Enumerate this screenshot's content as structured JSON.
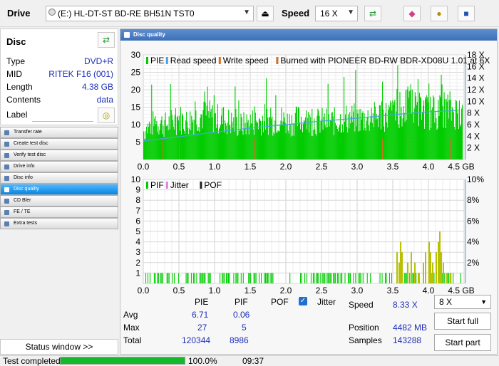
{
  "toolbar": {
    "drive_label": "Drive",
    "drive_value": "(E:)  HL-DT-ST BD-RE  BH51N TST0",
    "speed_label": "Speed",
    "speed_value": "16 X"
  },
  "disc": {
    "title": "Disc",
    "rows": [
      {
        "key": "Type",
        "value": "DVD+R"
      },
      {
        "key": "MID",
        "value": "RITEK F16 (001)"
      },
      {
        "key": "Length",
        "value": "4.38 GB"
      },
      {
        "key": "Contents",
        "value": "data"
      }
    ],
    "label_key": "Label",
    "label_value": ""
  },
  "nav": [
    {
      "label": "Transfer rate",
      "active": false
    },
    {
      "label": "Create test disc",
      "active": false
    },
    {
      "label": "Verify test disc",
      "active": false
    },
    {
      "label": "Drive info",
      "active": false
    },
    {
      "label": "Disc info",
      "active": false
    },
    {
      "label": "Disc quality",
      "active": true
    },
    {
      "label": "CD Bler",
      "active": false
    },
    {
      "label": "FE / TE",
      "active": false
    },
    {
      "label": "Extra tests",
      "active": false
    }
  ],
  "status_window": "Status window >>",
  "main_title": "Disc quality",
  "chart_data": [
    {
      "type": "bar",
      "legend": [
        "PIE",
        "Read speed",
        "Write speed",
        "Burned with PIONEER BD-RW  BDR-XD08U 1.01 at 6X"
      ],
      "legend_colors": [
        "#00cc00",
        "#4aa3e0",
        "#d07020",
        "#d07020"
      ],
      "x_ticks": [
        "0.0",
        "0.5",
        "1.0",
        "1.5",
        "2.0",
        "2.5",
        "3.0",
        "3.5",
        "4.0",
        "4.5 GB"
      ],
      "y_ticks_left": [
        "5",
        "10",
        "15",
        "20",
        "25",
        "30"
      ],
      "y_ticks_right": [
        "2 X",
        "4 X",
        "6 X",
        "8 X",
        "10 X",
        "12 X",
        "14 X",
        "16 X",
        "18 X"
      ],
      "xlim": [
        0,
        4.5
      ],
      "ylim": [
        0,
        30
      ],
      "y2lim": [
        0,
        18
      ],
      "pie_profile": [
        [
          0.0,
          9
        ],
        [
          0.1,
          11
        ],
        [
          0.2,
          12
        ],
        [
          0.3,
          11
        ],
        [
          0.4,
          12
        ],
        [
          0.5,
          13
        ],
        [
          0.6,
          12
        ],
        [
          0.7,
          13
        ],
        [
          0.8,
          14
        ],
        [
          0.9,
          14
        ],
        [
          1.0,
          13
        ],
        [
          1.1,
          13
        ],
        [
          1.2,
          12
        ],
        [
          1.3,
          11
        ],
        [
          1.4,
          11
        ],
        [
          1.5,
          12
        ],
        [
          1.6,
          12
        ],
        [
          1.7,
          13
        ],
        [
          1.8,
          12
        ],
        [
          1.9,
          13
        ],
        [
          2.0,
          12
        ],
        [
          2.1,
          12
        ],
        [
          2.2,
          13
        ],
        [
          2.3,
          12
        ],
        [
          2.4,
          12
        ],
        [
          2.5,
          12
        ],
        [
          2.6,
          12
        ],
        [
          2.7,
          12
        ],
        [
          2.8,
          13
        ],
        [
          2.9,
          13
        ],
        [
          3.0,
          13
        ],
        [
          3.1,
          13
        ],
        [
          3.2,
          13
        ],
        [
          3.3,
          14
        ],
        [
          3.4,
          14
        ],
        [
          3.5,
          15
        ],
        [
          3.6,
          16
        ],
        [
          3.7,
          17
        ],
        [
          3.8,
          16
        ],
        [
          3.9,
          16
        ],
        [
          4.0,
          15
        ],
        [
          4.1,
          15
        ],
        [
          4.2,
          16
        ],
        [
          4.3,
          16
        ],
        [
          4.4,
          15
        ],
        [
          4.48,
          14
        ]
      ],
      "read_speed": [
        [
          0.0,
          3.2
        ],
        [
          0.5,
          3.9
        ],
        [
          1.0,
          4.7
        ],
        [
          1.5,
          5.4
        ],
        [
          2.0,
          6.0
        ],
        [
          2.5,
          6.6
        ],
        [
          3.0,
          7.1
        ],
        [
          3.5,
          7.7
        ],
        [
          4.0,
          8.2
        ],
        [
          4.38,
          8.4
        ]
      ]
    },
    {
      "type": "bar",
      "legend": [
        "PIF",
        "Jitter",
        "POF"
      ],
      "legend_colors": [
        "#00cc00",
        "#e080e0",
        "#222222"
      ],
      "x_ticks": [
        "0.0",
        "0.5",
        "1.0",
        "1.5",
        "2.0",
        "2.5",
        "3.0",
        "3.5",
        "4.0",
        "4.5 GB"
      ],
      "y_ticks_left": [
        "1",
        "2",
        "3",
        "4",
        "5",
        "6",
        "7",
        "8",
        "9",
        "10"
      ],
      "y_ticks_right": [
        "2%",
        "4%",
        "6%",
        "8%",
        "10%"
      ],
      "xlim": [
        0,
        4.5
      ],
      "ylim": [
        0,
        10
      ],
      "y2lim": [
        0,
        10
      ],
      "spikes": [
        [
          3.55,
          3
        ],
        [
          3.58,
          2
        ],
        [
          3.6,
          4
        ],
        [
          3.62,
          3
        ],
        [
          3.7,
          2
        ],
        [
          3.75,
          3
        ],
        [
          3.8,
          2
        ],
        [
          3.85,
          1
        ],
        [
          3.92,
          2
        ],
        [
          3.95,
          3
        ],
        [
          4.0,
          4
        ],
        [
          4.02,
          3
        ],
        [
          4.05,
          2
        ],
        [
          4.1,
          3
        ],
        [
          4.13,
          4
        ],
        [
          4.15,
          5
        ],
        [
          4.17,
          3
        ],
        [
          4.2,
          2
        ],
        [
          4.25,
          1
        ],
        [
          4.3,
          1
        ]
      ]
    }
  ],
  "stats": {
    "col_pie": "PIE",
    "col_pif": "PIF",
    "col_pof": "POF",
    "jitter_label": "Jitter",
    "avg_label": "Avg",
    "max_label": "Max",
    "total_label": "Total",
    "avg_pie": "6.71",
    "avg_pif": "0.06",
    "max_pie": "27",
    "max_pif": "5",
    "total_pie": "120344",
    "total_pif": "8986",
    "speed_label": "Speed",
    "speed_value": "8.33 X",
    "position_label": "Position",
    "position_value": "4482 MB",
    "samples_label": "Samples",
    "samples_value": "143288",
    "speed_select": "8 X",
    "start_full": "Start full",
    "start_part": "Start part"
  },
  "statusbar": {
    "text": "Test completed",
    "progress": 100,
    "percent_text": "100.0%",
    "time": "09:37"
  }
}
